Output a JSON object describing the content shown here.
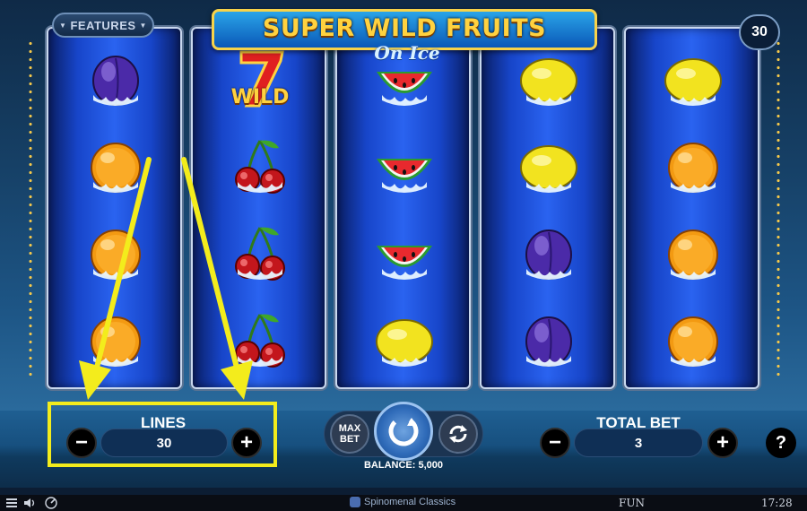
{
  "game": {
    "title": "SUPER WILD FRUITS",
    "subtitle": "On Ice"
  },
  "features_button": {
    "label": "FEATURES"
  },
  "autospins_badge": {
    "value": "30"
  },
  "reels": [
    [
      "plum",
      "orange",
      "orange",
      "orange"
    ],
    [
      "wild",
      "cherries",
      "cherries",
      "cherries"
    ],
    [
      "watermelon",
      "watermelon",
      "watermelon",
      "lemon"
    ],
    [
      "lemon",
      "lemon",
      "plum",
      "plum"
    ],
    [
      "lemon",
      "orange",
      "orange",
      "orange"
    ]
  ],
  "wild_label": "WILD",
  "controls": {
    "lines_label": "LINES",
    "lines_value": "30",
    "total_bet_label": "TOTAL BET",
    "total_bet_value": "3",
    "max_bet_line1": "MAX",
    "max_bet_line2": "BET",
    "balance": "BALANCE: 5,000",
    "minus": "−",
    "plus": "+",
    "help": "?"
  },
  "footer": {
    "brand": "Spinomenal Classics",
    "mode": "FUN",
    "clock": "17:28"
  },
  "colors": {
    "highlight": "#f3ec1c",
    "logo_gold": "#ffd23f",
    "reel_blue": "#2a63f0"
  },
  "icons": [
    "menu-icon",
    "sound-icon",
    "turbo-icon",
    "spin-icon",
    "autoplay-icon",
    "chevron-down-icon"
  ]
}
